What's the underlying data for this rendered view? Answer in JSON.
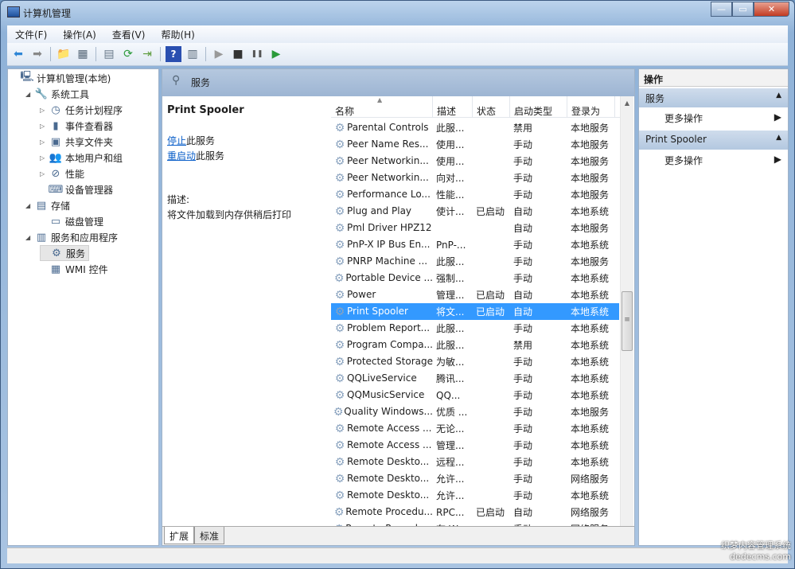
{
  "window": {
    "title": "计算机管理",
    "controls": [
      "—",
      "▭",
      "✕"
    ]
  },
  "menu": [
    "文件(F)",
    "操作(A)",
    "查看(V)",
    "帮助(H)"
  ],
  "toolbar": [
    "back-icon",
    "forward-icon",
    "up-folder-icon",
    "show-tree-icon",
    "properties-icon",
    "refresh-icon",
    "export-icon",
    "help-icon",
    "action-pane-icon",
    "start-icon",
    "stop-icon",
    "pause-icon",
    "resume-icon"
  ],
  "tree": [
    {
      "label": "计算机管理(本地)",
      "icon": "computer-icon",
      "level": 0,
      "exp": ""
    },
    {
      "label": "系统工具",
      "icon": "tools-icon",
      "level": 1,
      "exp": "◢"
    },
    {
      "label": "任务计划程序",
      "icon": "clock-icon",
      "level": 2,
      "exp": "▷"
    },
    {
      "label": "事件查看器",
      "icon": "event-viewer-icon",
      "level": 2,
      "exp": "▷"
    },
    {
      "label": "共享文件夹",
      "icon": "shared-folder-icon",
      "level": 2,
      "exp": "▷"
    },
    {
      "label": "本地用户和组",
      "icon": "users-icon",
      "level": 2,
      "exp": "▷"
    },
    {
      "label": "性能",
      "icon": "performance-icon",
      "level": 2,
      "exp": "▷"
    },
    {
      "label": "设备管理器",
      "icon": "device-manager-icon",
      "level": 2,
      "exp": ""
    },
    {
      "label": "存储",
      "icon": "storage-icon",
      "level": 1,
      "exp": "◢"
    },
    {
      "label": "磁盘管理",
      "icon": "disk-icon",
      "level": 2,
      "exp": ""
    },
    {
      "label": "服务和应用程序",
      "icon": "services-apps-icon",
      "level": 1,
      "exp": "◢"
    },
    {
      "label": "服务",
      "icon": "gear-icon",
      "level": 2,
      "exp": "",
      "selected": true
    },
    {
      "label": "WMI 控件",
      "icon": "wmi-icon",
      "level": 2,
      "exp": ""
    }
  ],
  "middle": {
    "header": "服务",
    "service_name": "Print Spooler",
    "stop_link": "停止",
    "stop_suffix": "此服务",
    "restart_link": "重启动",
    "restart_suffix": "此服务",
    "desc_label": "描述:",
    "desc_text": "将文件加载到内存供稍后打印",
    "tabs": [
      "扩展",
      "标准"
    ]
  },
  "columns": [
    "名称",
    "描述",
    "状态",
    "启动类型",
    "登录为"
  ],
  "rows": [
    [
      "Parental Controls",
      "此服...",
      "",
      "禁用",
      "本地服务"
    ],
    [
      "Peer Name Res...",
      "使用...",
      "",
      "手动",
      "本地服务"
    ],
    [
      "Peer Networkin...",
      "使用...",
      "",
      "手动",
      "本地服务"
    ],
    [
      "Peer Networkin...",
      "向对...",
      "",
      "手动",
      "本地服务"
    ],
    [
      "Performance Lo...",
      "性能...",
      "",
      "手动",
      "本地服务"
    ],
    [
      "Plug and Play",
      "使计...",
      "已启动",
      "自动",
      "本地系统"
    ],
    [
      "Pml Driver HPZ12",
      "",
      "",
      "自动",
      "本地服务"
    ],
    [
      "PnP-X IP Bus En...",
      "PnP-...",
      "",
      "手动",
      "本地系统"
    ],
    [
      "PNRP Machine ...",
      "此服...",
      "",
      "手动",
      "本地服务"
    ],
    [
      "Portable Device ...",
      "强制...",
      "",
      "手动",
      "本地系统"
    ],
    [
      "Power",
      "管理...",
      "已启动",
      "自动",
      "本地系统"
    ],
    [
      "Print Spooler",
      "将文...",
      "已启动",
      "自动",
      "本地系统"
    ],
    [
      "Problem Report...",
      "此服...",
      "",
      "手动",
      "本地系统"
    ],
    [
      "Program Compa...",
      "此服...",
      "",
      "禁用",
      "本地系统"
    ],
    [
      "Protected Storage",
      "为敏...",
      "",
      "手动",
      "本地系统"
    ],
    [
      "QQLiveService",
      "腾讯...",
      "",
      "手动",
      "本地系统"
    ],
    [
      "QQMusicService",
      "QQ...",
      "",
      "手动",
      "本地系统"
    ],
    [
      "Quality Windows...",
      "优质 ...",
      "",
      "手动",
      "本地服务"
    ],
    [
      "Remote Access ...",
      "无论...",
      "",
      "手动",
      "本地系统"
    ],
    [
      "Remote Access ...",
      "管理...",
      "",
      "手动",
      "本地系统"
    ],
    [
      "Remote Deskto...",
      "远程...",
      "",
      "手动",
      "本地系统"
    ],
    [
      "Remote Deskto...",
      "允许...",
      "",
      "手动",
      "网络服务"
    ],
    [
      "Remote Deskto...",
      "允许...",
      "",
      "手动",
      "本地系统"
    ],
    [
      "Remote Procedu...",
      "RPC...",
      "已启动",
      "自动",
      "网络服务"
    ],
    [
      "Remote Procedu...",
      "在 W...",
      "",
      "手动",
      "网络服务"
    ]
  ],
  "selected_row": 11,
  "actions": {
    "title": "操作",
    "sections": [
      {
        "label": "服务",
        "item": "更多操作"
      },
      {
        "label": "Print Spooler",
        "item": "更多操作"
      }
    ]
  },
  "watermark": [
    "织梦内容管理系统",
    "dedecms.com"
  ],
  "colors": {
    "selection": "#3399ff",
    "link": "#0b5fc9",
    "header_band": "#a7bdd8"
  }
}
